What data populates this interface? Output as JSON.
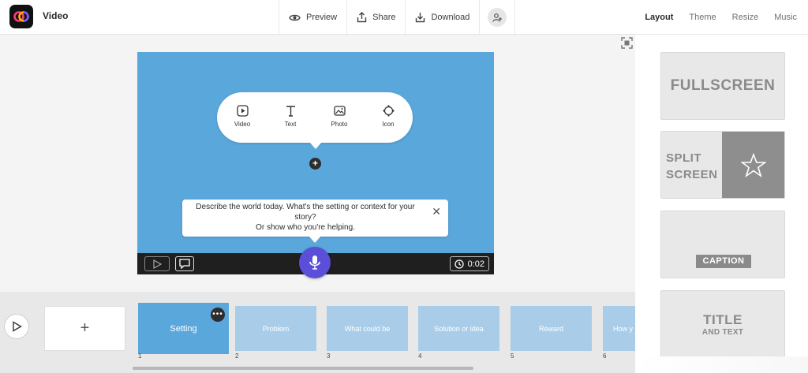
{
  "header": {
    "app_title": "Video",
    "actions": {
      "preview": "Preview",
      "share": "Share",
      "download": "Download"
    },
    "tabs": [
      "Layout",
      "Theme",
      "Resize",
      "Music"
    ]
  },
  "stage": {
    "media_options": [
      "Video",
      "Text",
      "Photo",
      "Icon"
    ],
    "prompt_line1": "Describe the world today. What's the setting or context for your story?",
    "prompt_line2": "Or show who you're helping.",
    "duration": "0:02"
  },
  "layouts": {
    "fullscreen": "FULLSCREEN",
    "split_line1": "SPLIT",
    "split_line2": "SCREEN",
    "caption": "CAPTION",
    "title_big": "TITLE",
    "title_small": "AND TEXT"
  },
  "timeline": {
    "add_label": "+",
    "scenes": [
      {
        "label": "Setting",
        "number": "1"
      },
      {
        "label": "Problem",
        "number": "2"
      },
      {
        "label": "What could be",
        "number": "3"
      },
      {
        "label": "Solution or idea",
        "number": "4"
      },
      {
        "label": "Reward",
        "number": "5"
      },
      {
        "label": "How y",
        "number": "6"
      }
    ]
  },
  "colors": {
    "stage": "#5aa7dc",
    "mic": "#5b4fd9",
    "scene": "#a9cde9"
  }
}
